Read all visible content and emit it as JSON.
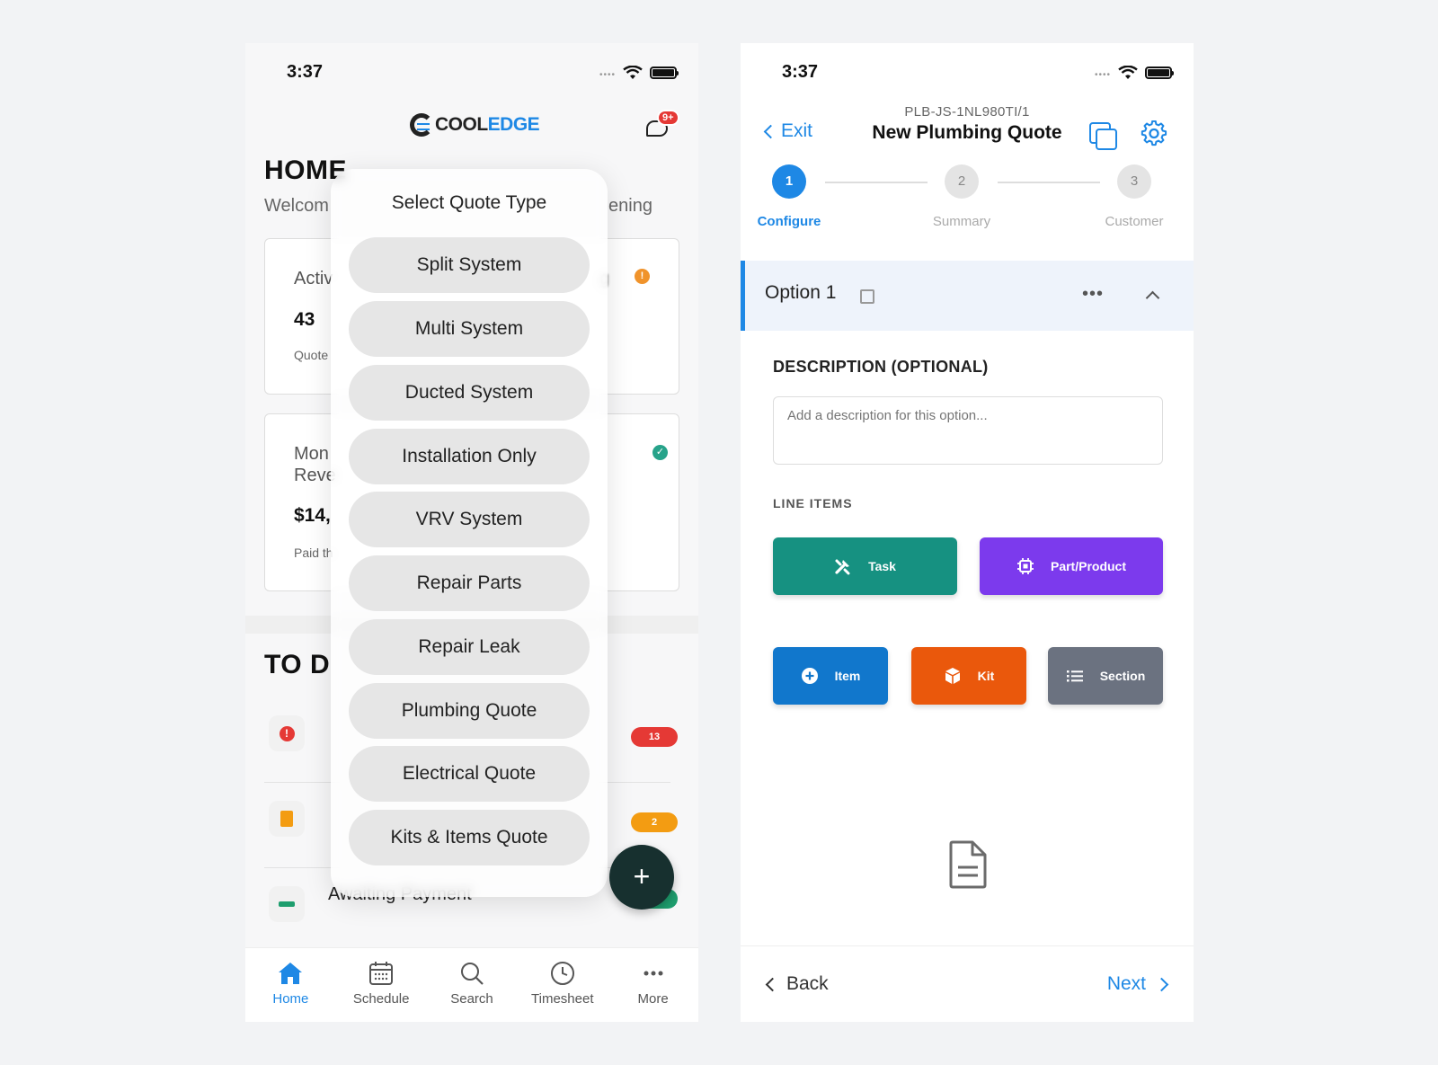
{
  "left": {
    "status_time": "3:37",
    "logo": {
      "text_a": "COOL",
      "text_b": "EDGE"
    },
    "notif_badge": "9+",
    "home_title": "HOME",
    "welcome_left": "Welcom",
    "welcome_right": "ening",
    "card1": {
      "label": "Activ",
      "value": "43",
      "sub": "Quote",
      "right_blur": "g"
    },
    "card2": {
      "label1": "Mon",
      "label2": "Reve",
      "value": "$14,",
      "sub": "Paid th"
    },
    "todo_title": "TO D",
    "todo_rows": [
      {
        "pill": "13",
        "pill_color": "#e53935"
      },
      {
        "pill": "2",
        "pill_color": "#f39c12"
      },
      {
        "pill": "5",
        "pill_color": "#1e9e6e"
      }
    ],
    "awaiting": "Awaiting Payment",
    "quote_popup": {
      "title": "Select Quote Type",
      "options": [
        "Split System",
        "Multi System",
        "Ducted System",
        "Installation Only",
        "VRV System",
        "Repair Parts",
        "Repair Leak",
        "Plumbing Quote",
        "Electrical Quote",
        "Kits & Items Quote"
      ]
    },
    "fab_icon": "+",
    "tabs": [
      {
        "label": "Home",
        "icon": "home-icon"
      },
      {
        "label": "Schedule",
        "icon": "calendar-icon"
      },
      {
        "label": "Search",
        "icon": "search-icon"
      },
      {
        "label": "Timesheet",
        "icon": "clock-icon"
      },
      {
        "label": "More",
        "icon": "more-icon"
      }
    ]
  },
  "right": {
    "status_time": "3:37",
    "quote_code": "PLB-JS-1NL980TI/1",
    "title": "New Plumbing Quote",
    "exit_label": "Exit",
    "steps": [
      {
        "num": "1",
        "label": "Configure"
      },
      {
        "num": "2",
        "label": "Summary"
      },
      {
        "num": "3",
        "label": "Customer"
      }
    ],
    "option_name": "Option 1",
    "more_icon": "•••",
    "description_label": "DESCRIPTION (OPTIONAL)",
    "description_placeholder": "Add a description for this option...",
    "line_items_label": "LINE ITEMS",
    "buttons": {
      "task": "Task",
      "part": "Part/Product",
      "item": "Item",
      "kit": "Kit",
      "section": "Section"
    },
    "back_label": "Back",
    "next_label": "Next"
  },
  "colors": {
    "accent": "#1e88e5",
    "task": "#169181",
    "part": "#7c3aed",
    "item": "#1177cc",
    "kit": "#ea580c",
    "section": "#6b7280"
  }
}
